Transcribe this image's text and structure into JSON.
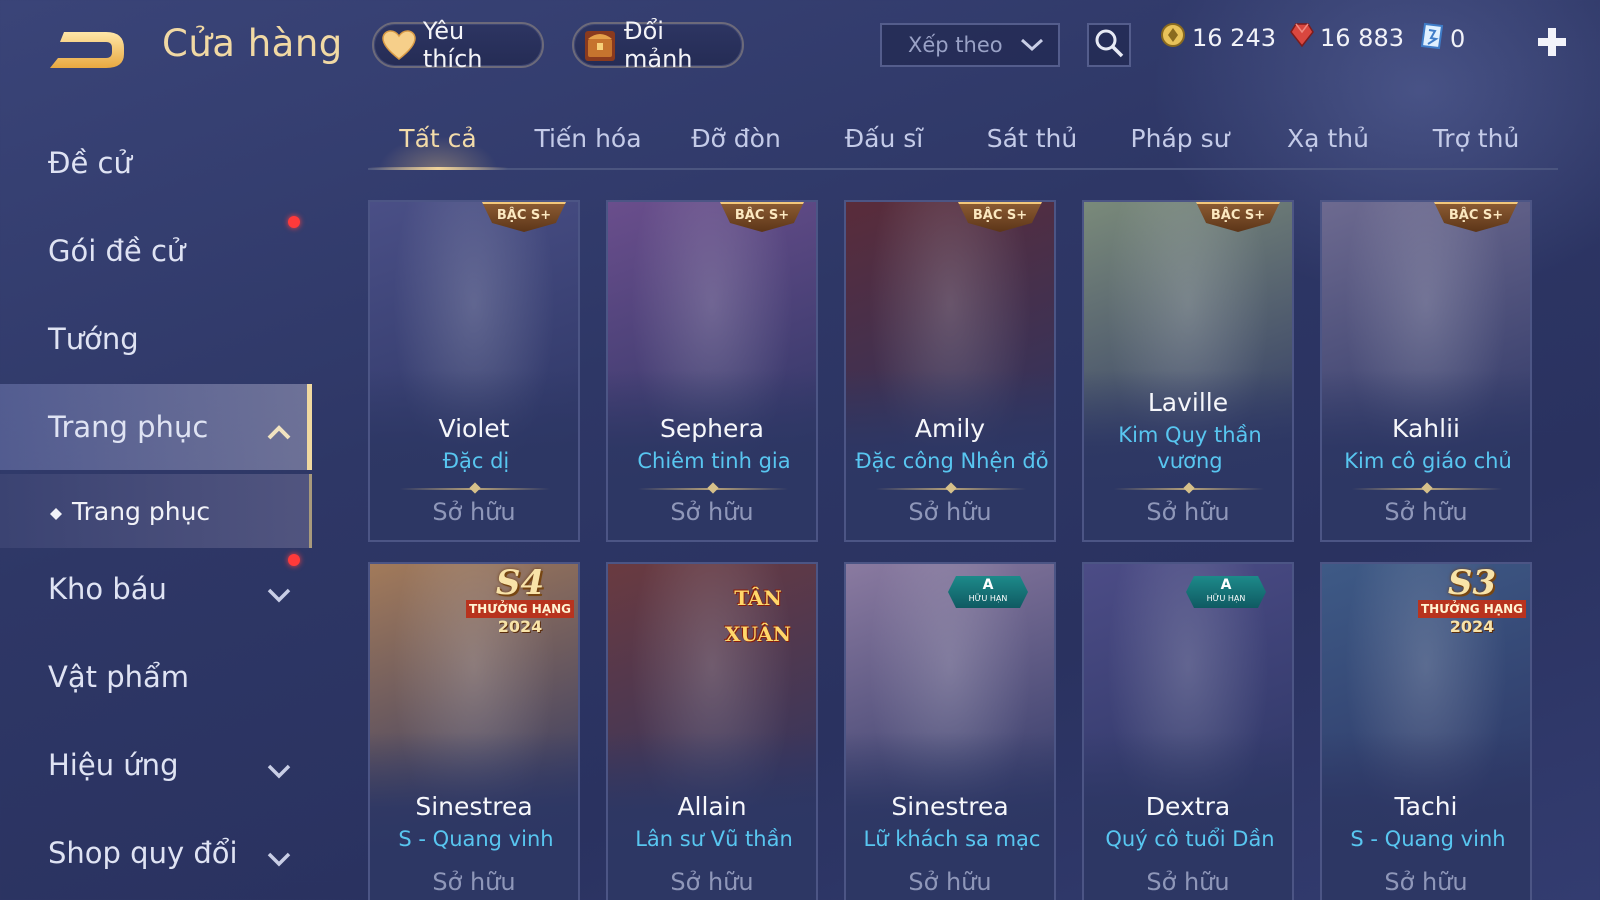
{
  "header": {
    "title": "Cửa hàng",
    "favorites_label": "Yêu thích",
    "shards_label": "Đổi mảnh",
    "sort_label": "Xếp theo"
  },
  "currencies": [
    {
      "name": "gold-coin",
      "value": "16 243",
      "color": "#e8c25a"
    },
    {
      "name": "ruby",
      "value": "16 883",
      "color": "#d9473f"
    },
    {
      "name": "voucher",
      "value": "0",
      "color": "#7db8f0"
    }
  ],
  "sidebar": {
    "items": [
      {
        "label": "Đề cử"
      },
      {
        "label": "Gói đề cử"
      },
      {
        "label": "Tướng"
      },
      {
        "label": "Trang phục"
      },
      {
        "label": "Kho báu"
      },
      {
        "label": "Vật phẩm"
      },
      {
        "label": "Hiệu ứng"
      },
      {
        "label": "Shop quy đổi"
      }
    ],
    "sub_item": "Trang phục"
  },
  "tabs": [
    "Tất cả",
    "Tiến hóa",
    "Đỡ đòn",
    "Đấu sĩ",
    "Sát thủ",
    "Pháp sư",
    "Xạ thủ",
    "Trợ thủ"
  ],
  "cards": [
    {
      "hero": "Violet",
      "skin": "Đặc dị",
      "status": "Sở hữu",
      "badge": "BẬC S+",
      "tone": "#4a4f86"
    },
    {
      "hero": "Sephera",
      "skin": "Chiêm tinh gia",
      "status": "Sở hữu",
      "badge": "BẬC S+",
      "tone": "#6a4e8c"
    },
    {
      "hero": "Amily",
      "skin": "Đặc công Nhện đỏ",
      "status": "Sở hữu",
      "badge": "BẬC S+",
      "tone": "#5a2c3a"
    },
    {
      "hero": "Laville",
      "skin": "Kim Quy thần vương",
      "status": "Sở hữu",
      "badge": "BẬC S+",
      "tone": "#7a8a7a"
    },
    {
      "hero": "Kahlii",
      "skin": "Kim cô giáo chủ",
      "status": "Sở hữu",
      "badge": "BẬC S+",
      "tone": "#6d6a90"
    },
    {
      "hero": "Sinestrea",
      "skin": "S - Quang vinh",
      "status": "Sở hữu",
      "season_big": "S4",
      "season_ribbon": "THƯỞNG HẠNG",
      "season_year": "2024",
      "tone": "#a27a5a"
    },
    {
      "hero": "Allain",
      "skin": "Lân sư Vũ thần",
      "status": "Sở hữu",
      "tet": "TÂN XUÂN",
      "tone": "#6a3a40"
    },
    {
      "hero": "Sinestrea",
      "skin": "Lữ khách sa mạc",
      "status": "Sở hữu",
      "a_badge": "A",
      "a_sub": "HỮU HẠN",
      "tone": "#8a7aa0"
    },
    {
      "hero": "Dextra",
      "skin": "Quý cô tuổi Dần",
      "status": "Sở hữu",
      "a_badge": "A",
      "a_sub": "HỮU HẠN",
      "tone": "#4c4c86"
    },
    {
      "hero": "Tachi",
      "skin": "S - Quang vinh",
      "status": "Sở hữu",
      "season_big": "S3",
      "season_ribbon": "THƯỞNG HẠNG",
      "season_year": "2024",
      "tone": "#3e5a86"
    }
  ]
}
